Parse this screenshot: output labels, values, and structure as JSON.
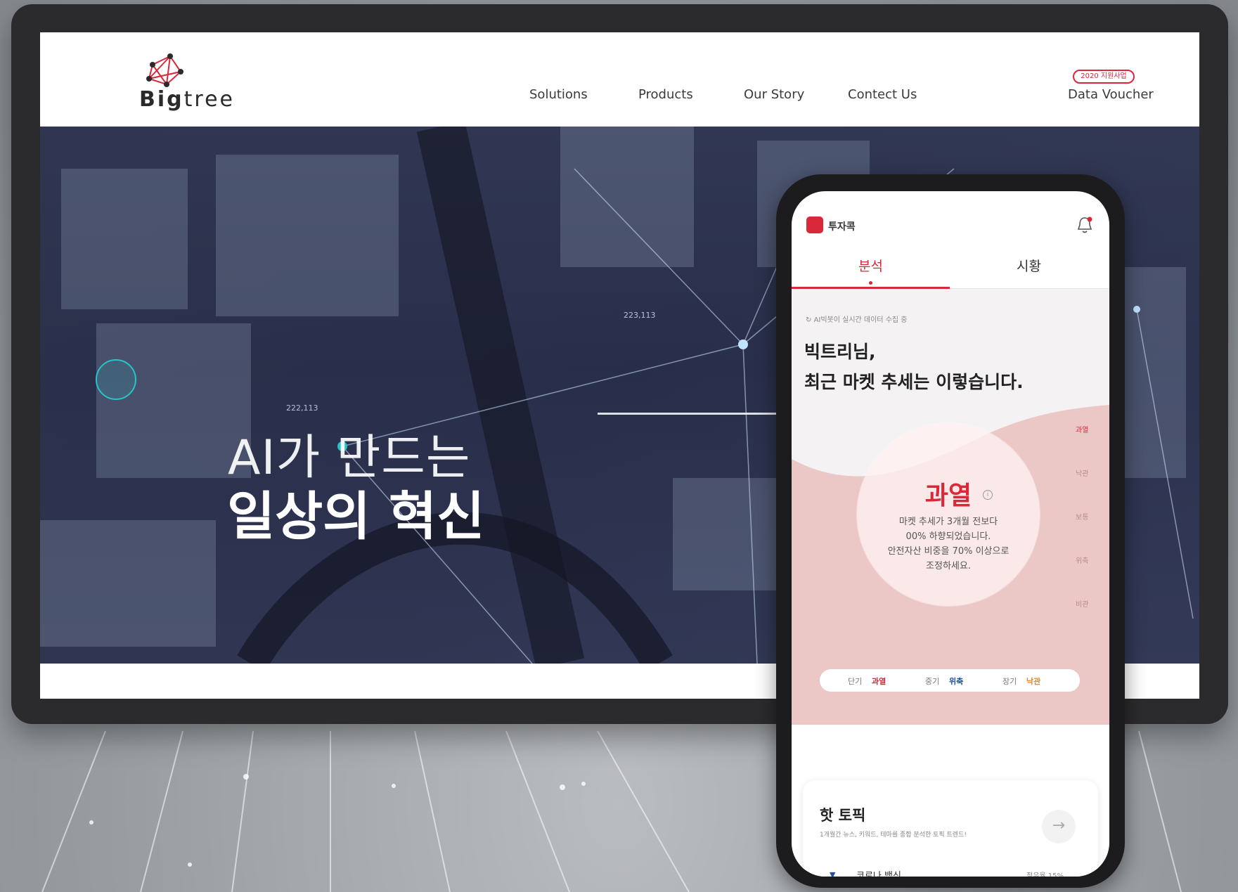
{
  "site": {
    "logo": {
      "bold": "Big",
      "light": "tree"
    },
    "nav": {
      "solutions": "Solutions",
      "products": "Products",
      "our_story": "Our Story",
      "contact_us": "Contect Us",
      "data_voucher": "Data Voucher",
      "data_voucher_badge": "2020 지원사업"
    },
    "hero": {
      "line1": "AI가 만드는",
      "line2": "일상의 혁신"
    },
    "overlay_numbers": [
      "223,113",
      "222,113",
      "223,113"
    ]
  },
  "app": {
    "name": "투자콕",
    "tabs": {
      "analysis": "분석",
      "market": "시황"
    },
    "status": "AI빅봇이 실시간 데이터 수집 중",
    "greeting_line1": "빅트리님,",
    "greeting_line2": "최근 마켓 추세는 이렇습니다.",
    "state": "과열",
    "info_icon": "i",
    "message": [
      "마켓 추세가 3개월 전보다",
      "00% 하향되었습니다.",
      "안전자산 비중을 70% 이상으로",
      "조정하세요."
    ],
    "scale": [
      "과열",
      "낙관",
      "보통",
      "위축",
      "비관"
    ],
    "terms": {
      "short_label": "단기",
      "short_value": "과열",
      "mid_label": "중기",
      "mid_value": "위축",
      "long_label": "장기",
      "long_value": "낙관"
    },
    "hot_topic": {
      "title": "핫 토픽",
      "subtitle": "1개월간 뉴스, 키워드, 테마를 종합 분석한 토픽 트렌드!",
      "arrow": "→",
      "items": [
        {
          "name": "코로나 백신",
          "share": "점유율 15%"
        }
      ]
    }
  },
  "colors": {
    "accent": "#d8283a",
    "blue": "#1f4fa8",
    "orange": "#e8862a",
    "pink": "#e9b7b7"
  }
}
